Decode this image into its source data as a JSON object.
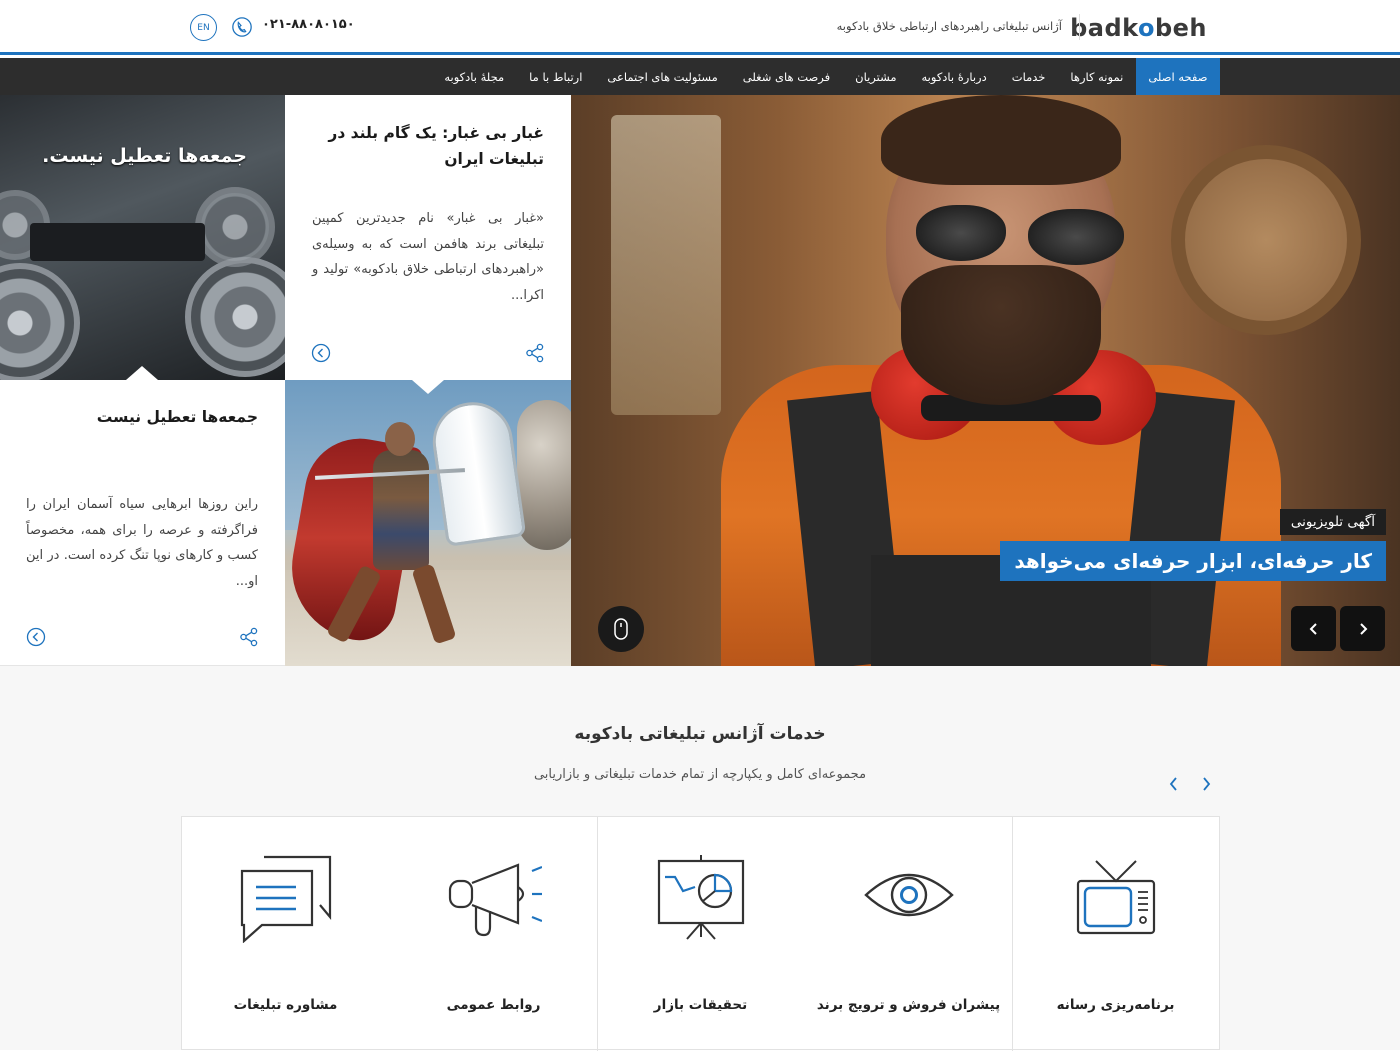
{
  "header": {
    "logo": "badkobeh",
    "tagline": "آژانس تبلیغاتی راهبردهای ارتباطی خلاق بادکوبه",
    "phone": "۰۲۱-۸۸۰۸۰۱۵۰",
    "lang": "EN"
  },
  "nav": {
    "items": [
      {
        "label": "صفحه اصلی",
        "active": true
      },
      {
        "label": "نمونه کارها"
      },
      {
        "label": "خدمات"
      },
      {
        "label": "دربارهٔ بادکوبه"
      },
      {
        "label": "مشتریان"
      },
      {
        "label": "فرصت های شغلی"
      },
      {
        "label": "مسئولیت های اجتماعی"
      },
      {
        "label": "ارتباط با ما"
      },
      {
        "label": "مجلهٔ بادکوبه"
      }
    ]
  },
  "hero": {
    "film_tile": {
      "caption": "جمعه‌ها تعطیل نیست."
    },
    "card_top": {
      "title": "غبار بی غبار: یک گام بلند در تبلیغات ایران",
      "body": "«غبار بی غبار» نام جدیدترین کمپین تبلیغاتی برند هافمن است که به وسیله‌ی «راهبردهای ارتباطی خلاق بادکوبه» تولید و اکرا..."
    },
    "card_bottom": {
      "title": "جمعه‌ها تعطیل نیست",
      "body": "راین روزها ابرهایی سیاه آسمان ایران را فراگرفته و عرصه را برای همه، مخصوصاً کسب و کارهای نوپا تنگ کرده است. در این او..."
    },
    "slider": {
      "label": "آگهی تلویزیونی",
      "title": "کار حرفه‌ای، ابزار حرفه‌ای می‌خواهد"
    }
  },
  "services": {
    "title": "خدمات آژانس تبلیغاتی بادکوبه",
    "subtitle": "مجموعه‌ای کامل و یکپارچه از تمام خدمات تبلیغاتی و بازاریابی",
    "items": [
      {
        "label": "برنامه‌ریزی رسانه",
        "icon": "tv-icon"
      },
      {
        "label": "پیشران فروش و ترویج برند",
        "icon": "eye-icon"
      },
      {
        "label": "تحقیقات بازار",
        "icon": "presentation-chart-icon"
      },
      {
        "label": "روابط عمومی",
        "icon": "megaphone-icon"
      },
      {
        "label": "مشاوره تبلیغات",
        "icon": "chat-bubbles-icon"
      }
    ]
  },
  "colors": {
    "accent": "#1e73be",
    "nav_bg": "#2d2d2d",
    "section_bg": "#f7f7f7"
  }
}
